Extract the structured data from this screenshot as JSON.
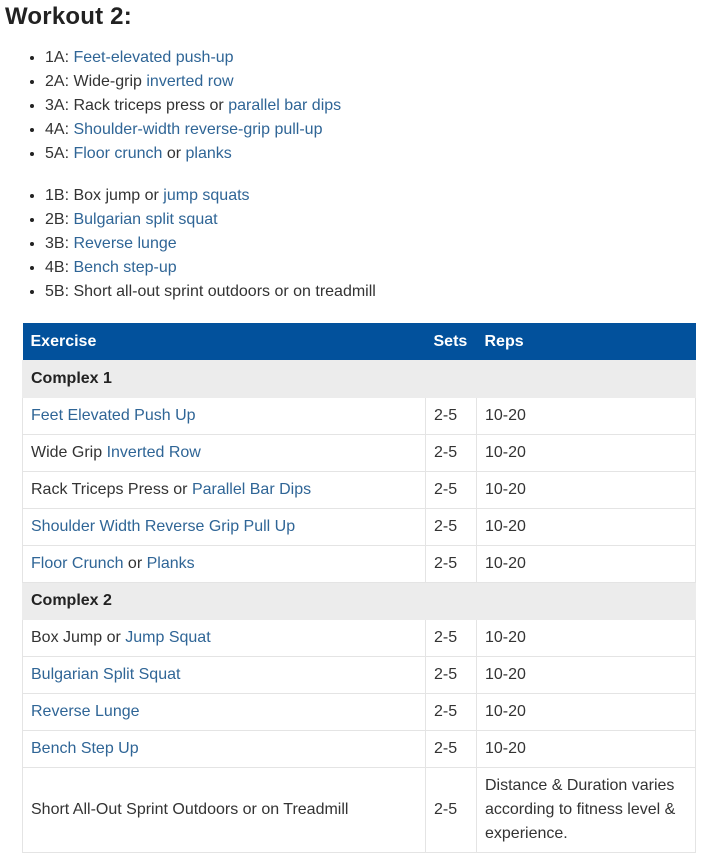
{
  "title": "Workout 2:",
  "list_a": [
    {
      "prefix": "1A: ",
      "parts": [
        {
          "text": "Feet-elevated push-up",
          "link": true
        }
      ]
    },
    {
      "prefix": "2A: ",
      "parts": [
        {
          "text": "Wide-grip ",
          "link": false
        },
        {
          "text": "inverted row",
          "link": true
        }
      ]
    },
    {
      "prefix": "3A: ",
      "parts": [
        {
          "text": "Rack triceps press or ",
          "link": false
        },
        {
          "text": "parallel bar dips",
          "link": true
        }
      ]
    },
    {
      "prefix": "4A: ",
      "parts": [
        {
          "text": "Shoulder-width reverse-grip pull-up",
          "link": true
        }
      ]
    },
    {
      "prefix": "5A: ",
      "parts": [
        {
          "text": "Floor crunch",
          "link": true
        },
        {
          "text": " or ",
          "link": false
        },
        {
          "text": "planks",
          "link": true
        }
      ]
    }
  ],
  "list_b": [
    {
      "prefix": "1B: ",
      "parts": [
        {
          "text": "Box jump or ",
          "link": false
        },
        {
          "text": "jump squats",
          "link": true
        }
      ]
    },
    {
      "prefix": "2B: ",
      "parts": [
        {
          "text": "Bulgarian split squat",
          "link": true
        }
      ]
    },
    {
      "prefix": "3B: ",
      "parts": [
        {
          "text": "Reverse lunge",
          "link": true
        }
      ]
    },
    {
      "prefix": "4B: ",
      "parts": [
        {
          "text": "Bench step-up",
          "link": true
        }
      ]
    },
    {
      "prefix": "5B: ",
      "parts": [
        {
          "text": "Short all-out sprint outdoors or on treadmill",
          "link": false
        }
      ]
    }
  ],
  "table": {
    "headers": {
      "exercise": "Exercise",
      "sets": "Sets",
      "reps": "Reps"
    },
    "complex1_label": "Complex 1",
    "complex2_label": "Complex 2",
    "complex1": [
      {
        "parts": [
          {
            "text": "Feet Elevated Push Up",
            "link": true
          }
        ],
        "sets": "2-5",
        "reps": "10-20"
      },
      {
        "parts": [
          {
            "text": "Wide Grip ",
            "link": false
          },
          {
            "text": "Inverted Row",
            "link": true
          }
        ],
        "sets": "2-5",
        "reps": "10-20"
      },
      {
        "parts": [
          {
            "text": "Rack Triceps Press or ",
            "link": false
          },
          {
            "text": "Parallel Bar Dips",
            "link": true
          }
        ],
        "sets": "2-5",
        "reps": "10-20"
      },
      {
        "parts": [
          {
            "text": "Shoulder Width Reverse Grip Pull Up",
            "link": true
          }
        ],
        "sets": "2-5",
        "reps": "10-20"
      },
      {
        "parts": [
          {
            "text": "Floor Crunch",
            "link": true
          },
          {
            "text": " or ",
            "link": false
          },
          {
            "text": "Planks",
            "link": true
          }
        ],
        "sets": "2-5",
        "reps": "10-20"
      }
    ],
    "complex2": [
      {
        "parts": [
          {
            "text": "Box Jump or ",
            "link": false
          },
          {
            "text": "Jump Squat",
            "link": true
          }
        ],
        "sets": "2-5",
        "reps": "10-20"
      },
      {
        "parts": [
          {
            "text": "Bulgarian Split Squat",
            "link": true
          }
        ],
        "sets": "2-5",
        "reps": "10-20"
      },
      {
        "parts": [
          {
            "text": "Reverse Lunge",
            "link": true
          }
        ],
        "sets": "2-5",
        "reps": "10-20"
      },
      {
        "parts": [
          {
            "text": "Bench Step Up",
            "link": true
          }
        ],
        "sets": "2-5",
        "reps": "10-20"
      },
      {
        "parts": [
          {
            "text": "Short All-Out Sprint Outdoors or on Treadmill",
            "link": false
          }
        ],
        "sets": "2-5",
        "reps": "Distance & Duration varies according to fitness level & experience."
      }
    ]
  },
  "colors": {
    "link": "#2f6596",
    "header_bg": "#02519c",
    "group_bg": "#ececec"
  }
}
